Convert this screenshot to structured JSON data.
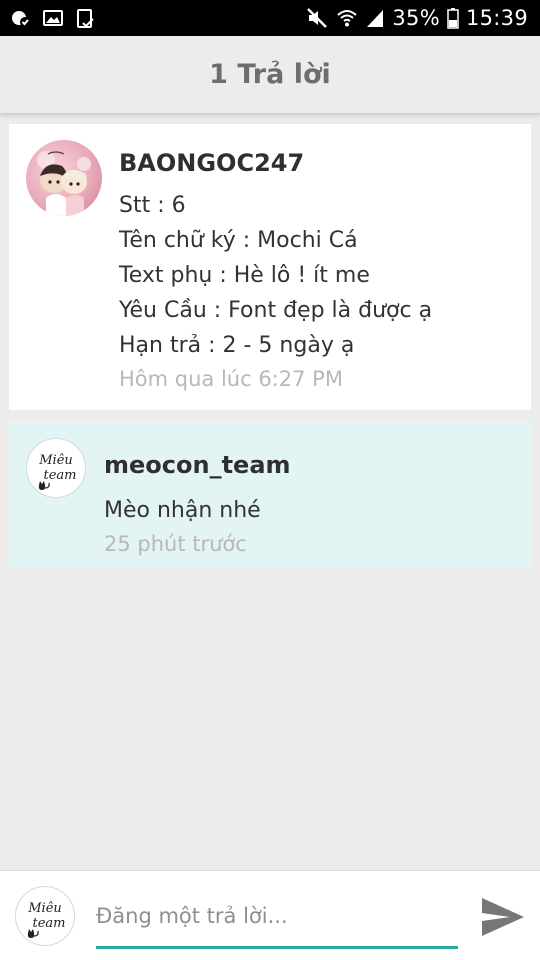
{
  "status_bar": {
    "icons": [
      "signal-app-icon",
      "image-icon",
      "clipboard-check-icon",
      "mute-icon",
      "wifi-icon",
      "cell-signal-icon",
      "battery-icon"
    ],
    "battery": "35%",
    "time": "15:39"
  },
  "header": {
    "title": "1 Trả lời"
  },
  "posts": [
    {
      "username": "BAONGOC247",
      "avatar": "anime-couple-avatar",
      "lines": [
        "Stt : 6",
        "Tên chữ ký : Mochi Cá",
        "Text phụ : Hè lô ! ít me",
        "Yêu Cầu : Font đẹp là được ạ",
        "Hạn trả : 2 - 5 ngày ạ"
      ],
      "time": "Hôm qua lúc 6:27 PM"
    },
    {
      "username": "meocon_team",
      "avatar": "mieu-team-logo",
      "avatar_text": "Miêu team",
      "lines": [
        "Mèo nhận nhé"
      ],
      "time": "25 phút trước"
    }
  ],
  "reply": {
    "placeholder": "Đăng một trả lời...",
    "value": "",
    "avatar_text": "Miêu team",
    "send_icon": "send-icon"
  },
  "colors": {
    "background": "#ececec",
    "highlight_card": "#e3f4f5",
    "accent": "#2aa7a2",
    "muted_text": "#b8b8b8"
  }
}
